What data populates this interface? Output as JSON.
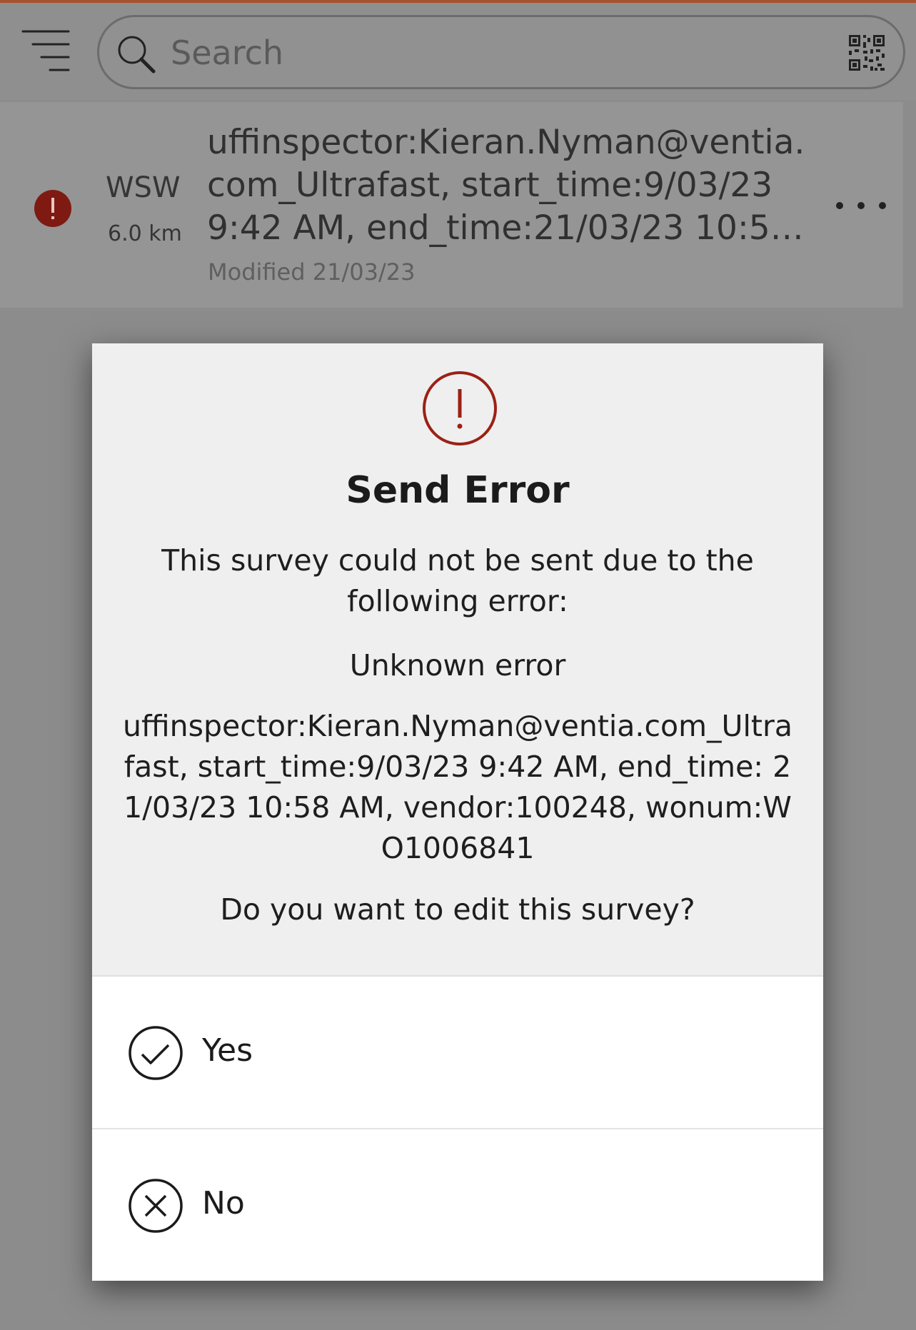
{
  "colors": {
    "accent": "#a5532f",
    "error": "#8b1d12"
  },
  "search": {
    "placeholder": "Search"
  },
  "survey_item": {
    "direction": "WSW",
    "distance": "6.0 km",
    "title": "uffinspector:Kieran.Nyman@ventia.com_Ultrafast, start_time:9/03/23 9:42 AM, end_time:21/03/23 10:58 AM, vendor:100248, wonum:WO1006841",
    "modified": "Modified 21/03/23"
  },
  "dialog": {
    "title": "Send Error",
    "message": "This survey could not be sent due to the following error:",
    "error": "Unknown error",
    "details": "uffinspector:Kieran.Nyman@ventia.com_Ultrafast, start_time:9/03/23 9:42 AM, end_time: 21/03/23 10:58 AM, vendor:100248, wonum:WO1006841",
    "question": "Do you want to edit this survey?",
    "options": [
      {
        "label": "Yes",
        "icon": "check-circle-icon"
      },
      {
        "label": "No",
        "icon": "x-circle-icon"
      }
    ]
  }
}
